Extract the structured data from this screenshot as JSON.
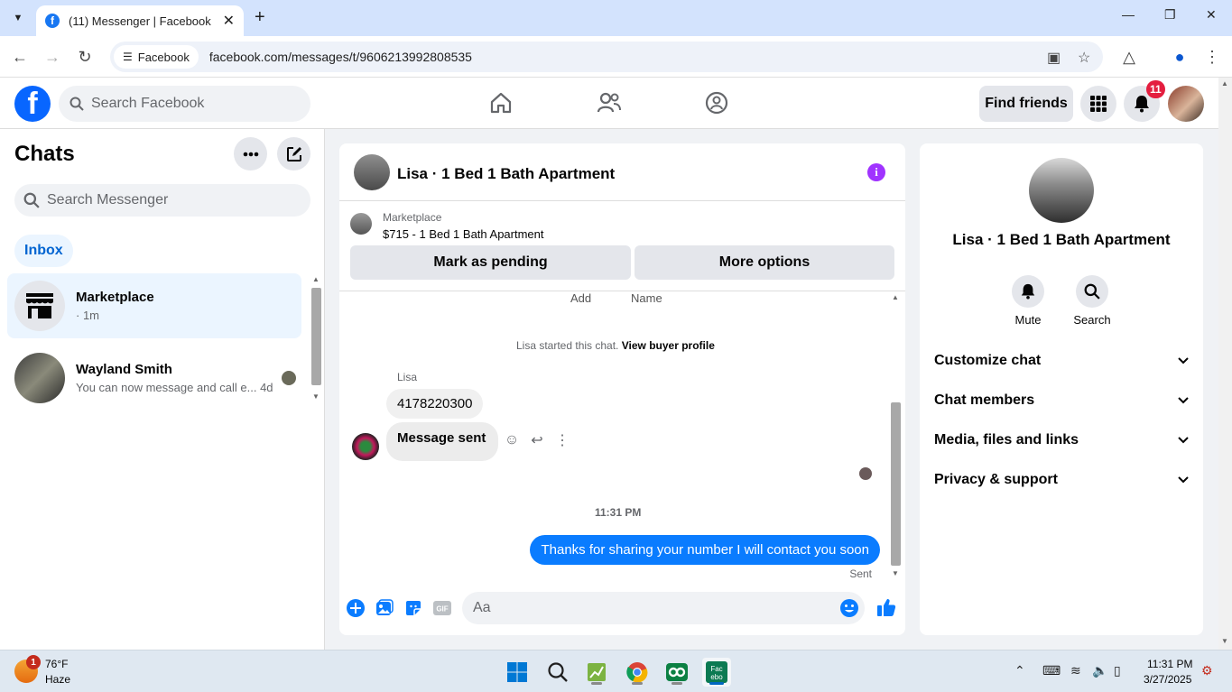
{
  "browser": {
    "tab_title": "(11) Messenger | Facebook",
    "site_chip": "Facebook",
    "url": "facebook.com/messages/t/9606213992808535"
  },
  "fb": {
    "search_placeholder": "Search Facebook",
    "find_friends": "Find friends",
    "notification_count": "11"
  },
  "chats": {
    "title": "Chats",
    "search_placeholder": "Search Messenger",
    "filter": "Inbox",
    "items": [
      {
        "name": "Marketplace",
        "preview": "· 1m"
      },
      {
        "name": "Wayland Smith",
        "preview": "You can now message and call e...",
        "time": "4d"
      }
    ]
  },
  "conversation": {
    "title": "Lisa · 1 Bed 1 Bath Apartment",
    "marketplace_label": "Marketplace",
    "listing": "$715 - 1 Bed 1 Bath Apartment",
    "mark_pending": "Mark as pending",
    "more_options": "More options",
    "cut_add": "Add",
    "cut_name": "Name",
    "started_text": "Lisa started this chat.",
    "view_profile": "View buyer profile",
    "sender": "Lisa",
    "messages_in": [
      "4178220300",
      "Message sent"
    ],
    "timestamp": "11:31 PM",
    "message_out": "Thanks for sharing your number I will contact you soon",
    "sent_label": "Sent",
    "composer_placeholder": "Aa"
  },
  "info_panel": {
    "name": "Lisa · 1 Bed 1 Bath Apartment",
    "actions": [
      "Mute",
      "Search"
    ],
    "sections": [
      "Customize chat",
      "Chat members",
      "Media, files and links",
      "Privacy & support"
    ]
  },
  "taskbar": {
    "temperature": "76°F",
    "condition": "Haze",
    "weather_badge": "1",
    "time": "11:31 PM",
    "date": "3/27/2025"
  },
  "colors": {
    "fb_blue": "#0866ff",
    "messenger_blue": "#0a7cff",
    "accent_purple": "#a033ff",
    "notification_red": "#e41e3f"
  }
}
